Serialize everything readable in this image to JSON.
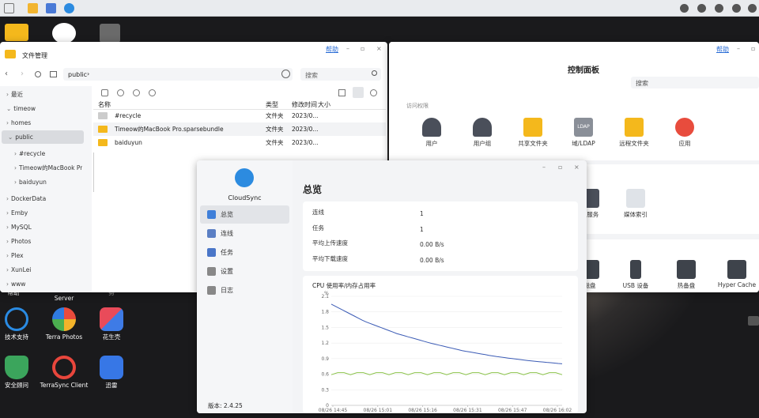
{
  "taskbar": {
    "icons": [
      "window-icon",
      "folder-icon",
      "control-panel-icon",
      "cloudsync-icon"
    ],
    "tray": [
      "message-icon",
      "chat-icon",
      "bell-icon",
      "globe-icon",
      "user-icon"
    ]
  },
  "desktop": {
    "row1": [
      {
        "label": "帮助"
      },
      {
        "label": "Server"
      },
      {
        "label": "务"
      }
    ],
    "row2": [
      {
        "label": "技术支持"
      },
      {
        "label": "Terra Photos"
      },
      {
        "label": "花生壳"
      }
    ],
    "row3": [
      {
        "label": "安全顾问"
      },
      {
        "label": "TerraSync Client"
      },
      {
        "label": "迅雷"
      }
    ]
  },
  "file_manager": {
    "title": "文件管理",
    "help": "帮助",
    "path": "public",
    "search_placeholder": "搜索",
    "sidebar": [
      "最近",
      "timeow",
      "homes",
      "public",
      "#recycle",
      "Timeow的MacBook Pro.sparsebundle",
      "baiduyun",
      "DockerData",
      "Emby",
      "MySQL",
      "Photos",
      "Plex",
      "XunLei",
      "www"
    ],
    "columns": {
      "name": "名称",
      "type": "类型",
      "modified": "修改时间",
      "size": "大小"
    },
    "files": [
      {
        "name": "#recycle",
        "type": "文件夹",
        "modified": "2023/0..."
      },
      {
        "name": "Timeow的MacBook Pro.sparsebundle",
        "type": "文件夹",
        "modified": "2023/0..."
      },
      {
        "name": "baiduyun",
        "type": "文件夹",
        "modified": "2023/0..."
      }
    ]
  },
  "control_panel": {
    "title": "控制面板",
    "help": "帮助",
    "search_placeholder": "搜索",
    "section": "访问权限",
    "access": [
      "用户",
      "用户组",
      "共享文件夹",
      "域/LDAP",
      "远程文件夹",
      "应用"
    ],
    "ldap_badge": "LDAP",
    "services": [
      "索服务",
      "媒体索引"
    ],
    "hardware": [
      "磁盘",
      "USB 设备",
      "热备盘",
      "Hyper Cache"
    ]
  },
  "cloudsync": {
    "app_name": "CloudSync",
    "version": "版本: 2.4.25",
    "nav": [
      "总览",
      "连线",
      "任务",
      "设置",
      "日志"
    ],
    "heading": "总览",
    "stats": [
      {
        "label": "连线",
        "value": "1"
      },
      {
        "label": "任务",
        "value": "1"
      },
      {
        "label": "平均上传速度",
        "value": "0.00 B/s"
      },
      {
        "label": "平均下载速度",
        "value": "0.00 B/s"
      }
    ]
  },
  "chart_data": {
    "type": "line",
    "title": "CPU 使用率/内存占用率",
    "ylabel": "%",
    "ylim": [
      0,
      2.1
    ],
    "yticks": [
      "0",
      "0.3",
      "0.6",
      "0.9",
      "1.2",
      "1.5",
      "1.8",
      "2.1"
    ],
    "x": [
      "08/26 14:45",
      "08/26 15:01",
      "08/26 15:16",
      "08/26 15:31",
      "08/26 15:47",
      "08/26 16:02"
    ],
    "series": [
      {
        "color": "#3b5bb5",
        "values": [
          1.95,
          1.62,
          1.38,
          1.2,
          1.05,
          0.94,
          0.86,
          0.8
        ]
      },
      {
        "color": "#8bc34a",
        "values": [
          0.62,
          0.63,
          0.63,
          0.62,
          0.63,
          0.63,
          0.62,
          0.63
        ]
      }
    ]
  }
}
